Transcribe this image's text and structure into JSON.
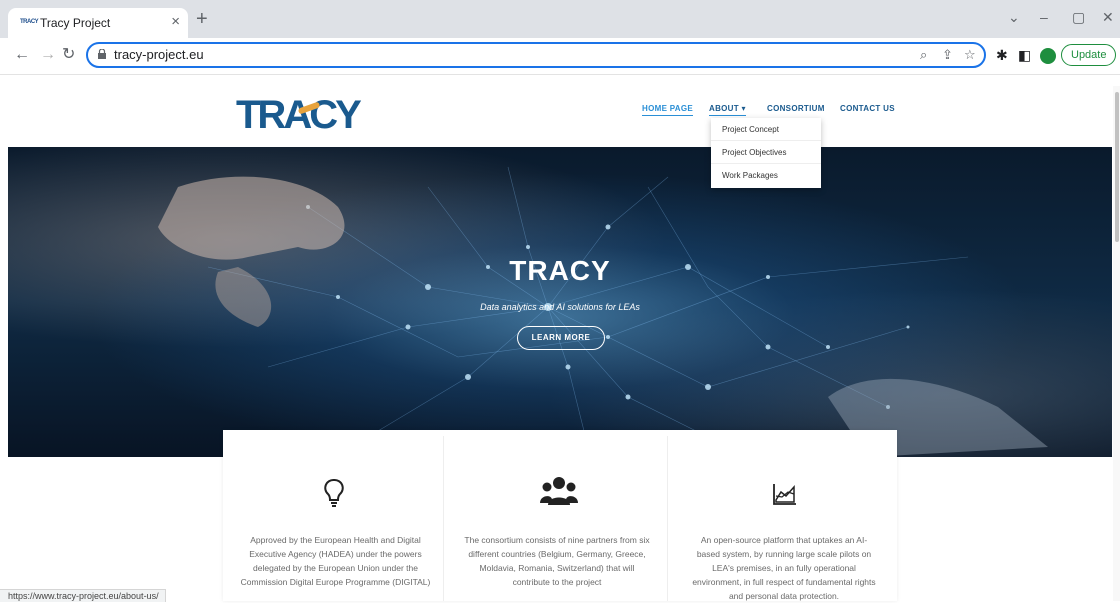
{
  "browser": {
    "tab_title": "Tracy Project",
    "tab_favicon_text": "TRACY",
    "url": "tracy-project.eu",
    "update_label": "Update",
    "status_url": "https://www.tracy-project.eu/about-us/"
  },
  "site": {
    "logo_text": "TRACY",
    "nav": [
      {
        "label": "HOME PAGE"
      },
      {
        "label": "ABOUT ▾"
      },
      {
        "label": "CONSORTIUM"
      },
      {
        "label": "CONTACT US"
      }
    ],
    "about_dropdown": [
      {
        "label": "Project Concept"
      },
      {
        "label": "Project Objectives"
      },
      {
        "label": "Work Packages"
      }
    ]
  },
  "hero": {
    "title": "TRACY",
    "subtitle": "Data analytics and AI solutions for LEAs",
    "button_label": "LEARN MORE"
  },
  "features": [
    {
      "icon": "lightbulb-icon",
      "text": "Approved by the European Health and Digital Executive Agency (HADEA) under the powers delegated by the European Union under the Commission Digital Europe Programme (DIGITAL)"
    },
    {
      "icon": "users-icon",
      "text": "The consortium consists of nine partners from six different countries (Belgium, Germany, Greece, Moldavia, Romania, Switzerland) that will contribute to the project"
    },
    {
      "icon": "chart-area-icon",
      "text": "An open-source platform that uptakes an AI-based system, by running large scale pilots on LEA's premises, in an fully operational environment, in full respect of fundamental rights and personal data protection."
    }
  ],
  "colors": {
    "brand": "#1a5a8e",
    "nav_active": "#2a8fd6",
    "accent": "#e8a33c",
    "omnibox_focus": "#1a73e8"
  }
}
